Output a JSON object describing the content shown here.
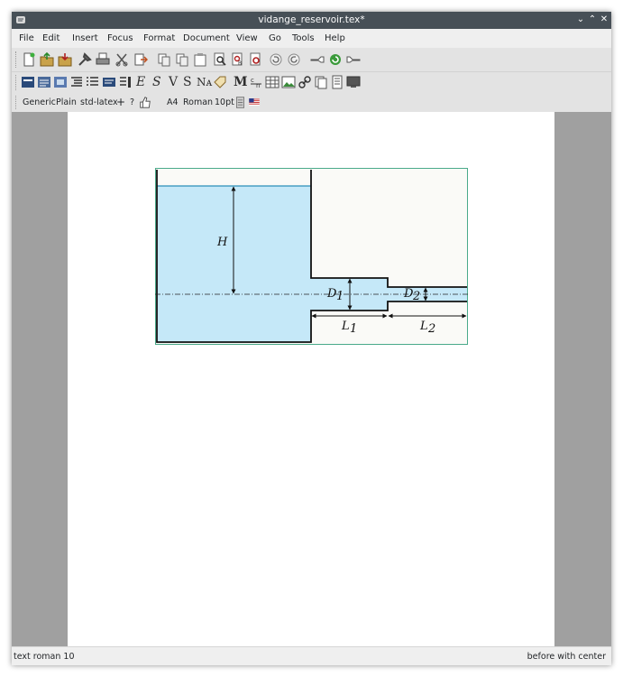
{
  "window": {
    "title": "vidange_reservoir.tex*"
  },
  "menu": [
    "File",
    "Edit",
    "Insert",
    "Focus",
    "Format",
    "Document",
    "View",
    "Go",
    "Tools",
    "Help"
  ],
  "toolbar2": {
    "glyph_e": "E",
    "glyph_s": "S",
    "glyph_v": "V",
    "glyph_s2": "S",
    "glyph_na": "Nᴀ",
    "glyph_m": "M"
  },
  "format_bar": {
    "style": "Generic",
    "variant": "Plain",
    "package": "std-latex",
    "plus": "+",
    "question": "?",
    "paper": "A4",
    "font": "Roman",
    "size": "10pt"
  },
  "figure": {
    "label_H": "H",
    "label_D1": "D",
    "label_D1_sub": "1",
    "label_D2": "D",
    "label_D2_sub": "2",
    "label_L1": "L",
    "label_L1_sub": "1",
    "label_L2": "L",
    "label_L2_sub": "2",
    "water_color": "#c5e8f8",
    "frame_color": "#4aaa8a"
  },
  "status": {
    "left": "text roman 10",
    "right": "before with center"
  },
  "colors": {
    "titlebar": "#475057",
    "canvas": "#a0a0a0",
    "toolbar": "#e3e3e3"
  }
}
